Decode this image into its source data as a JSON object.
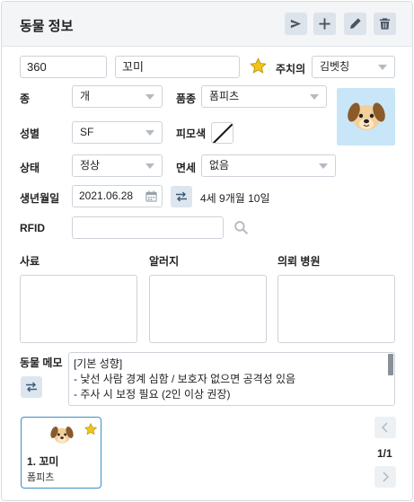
{
  "header": {
    "title": "동물 정보"
  },
  "basic": {
    "chart_number": "360",
    "name": "꼬미",
    "doctor": "김벳칭"
  },
  "labels": {
    "doctor": "주치의",
    "species": "종",
    "breed": "품종",
    "sex": "성별",
    "coat_color": "피모색",
    "status": "상태",
    "exemption": "면세",
    "birth": "생년월일",
    "rfid": "RFID",
    "feed": "사료",
    "allergy": "알러지",
    "referral": "의뢰 병원",
    "memo": "동물 메모"
  },
  "fields": {
    "species": "개",
    "breed": "폼피츠",
    "sex": "SF",
    "status": "정상",
    "exemption": "없음",
    "birth_date": "2021.06.28",
    "age": "4세 9개월 10일",
    "rfid": ""
  },
  "memo": {
    "lines": [
      "[기본 성향]",
      "- 낯선 사람 경계 심함 / 보호자 없으면 공격성 있음",
      "- 주사 시 보정 필요 (2인 이상 권장)"
    ]
  },
  "animal_list": {
    "items": [
      {
        "title": "1. 꼬미",
        "breed": "폼피츠"
      }
    ]
  },
  "pager": {
    "count": "1/1"
  },
  "icons": {
    "send": "send-icon",
    "add": "plus-icon",
    "edit": "pencil-icon",
    "delete": "trash-icon",
    "favorite": "star-icon",
    "calendar": "calendar-icon",
    "swap": "swap-icon",
    "search": "search-icon",
    "prev": "chevron-left-icon",
    "next": "chevron-right-icon",
    "avatar": "dog-icon"
  },
  "colors": {
    "accent": "#3d8fc5",
    "header_bg": "#f3f5f7",
    "button_bg": "#dde3ea",
    "star": "#f0c419",
    "avatar_bg": "#c8e6f7"
  }
}
